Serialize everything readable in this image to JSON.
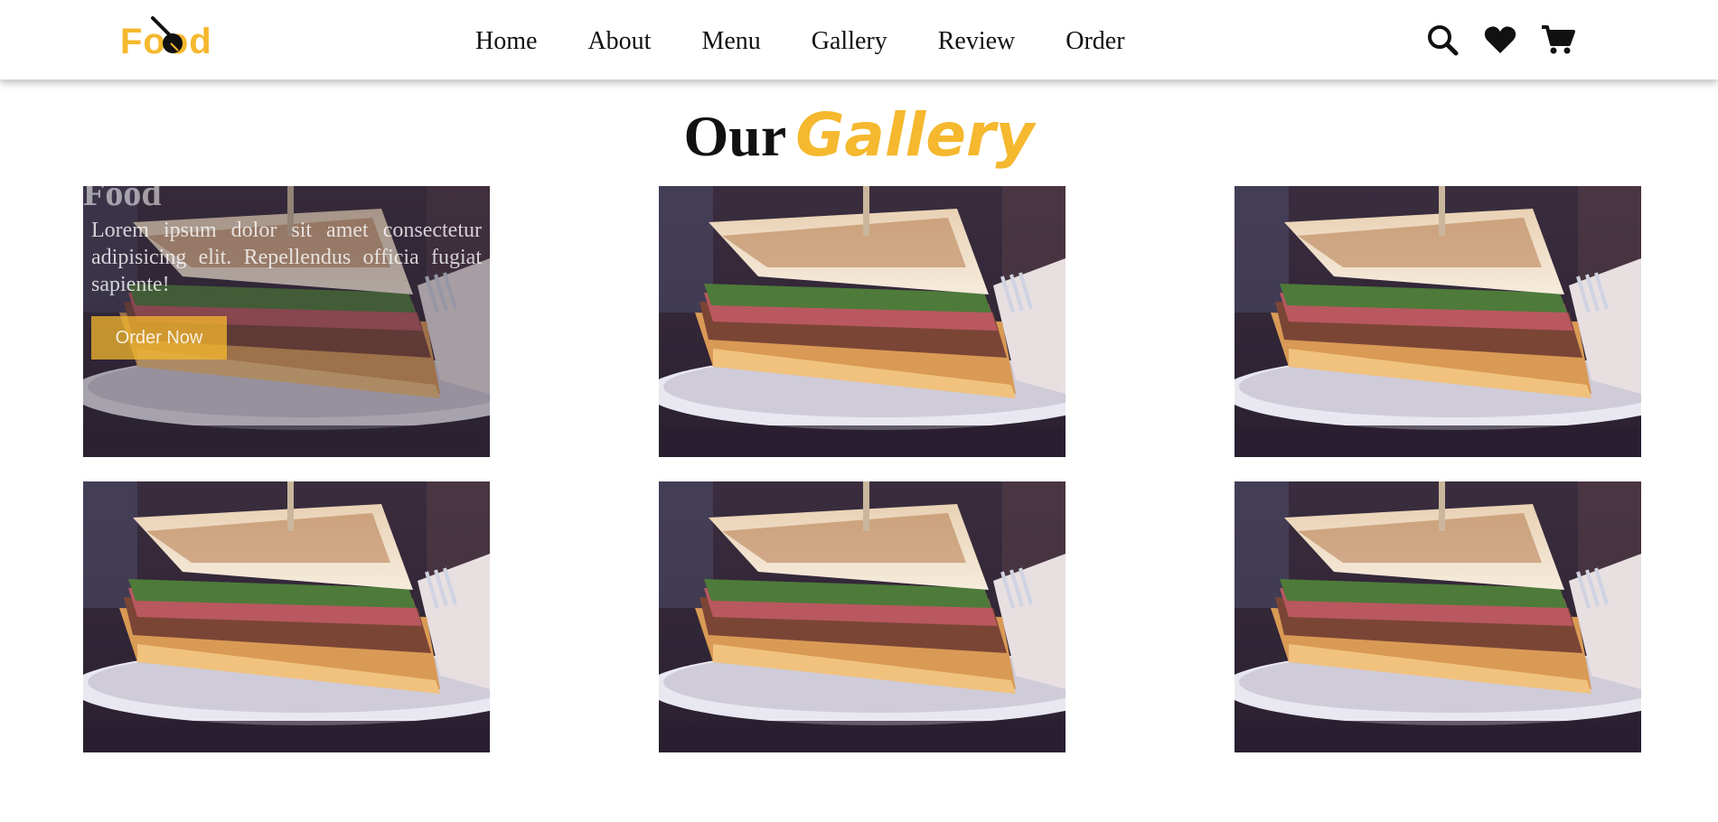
{
  "header": {
    "logo_text": "Food",
    "nav": [
      {
        "label": "Home"
      },
      {
        "label": "About"
      },
      {
        "label": "Menu"
      },
      {
        "label": "Gallery"
      },
      {
        "label": "Review"
      },
      {
        "label": "Order"
      }
    ],
    "icons": [
      "search-icon",
      "heart-icon",
      "cart-icon"
    ]
  },
  "section": {
    "title_plain": "Our",
    "title_accent": "Gallery"
  },
  "gallery": {
    "featured": {
      "title": "Food",
      "text": "Lorem ipsum dolor sit amet consectetur adipisicing elit. Repellendus officia fugiat sapiente!",
      "button_label": "Order Now"
    },
    "image_alt": "sandwich"
  },
  "colors": {
    "accent": "#f5b82e",
    "text": "#111111",
    "photo_bg": "#2e2433"
  }
}
